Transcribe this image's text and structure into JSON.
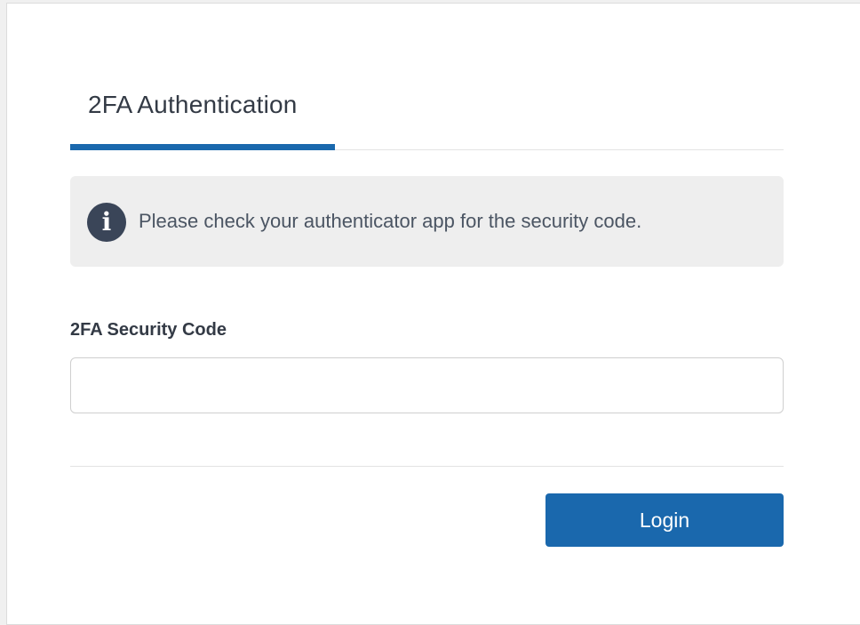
{
  "colors": {
    "accent": "#1a68ad",
    "alert_background": "#eeeeee",
    "icon_background": "#3a4558"
  },
  "tabs": [
    {
      "label": "2FA Authentication",
      "active": true
    }
  ],
  "alert": {
    "icon": "info-icon",
    "icon_glyph": "i",
    "message": "Please check your authenticator app for the security code."
  },
  "form": {
    "code_label": "2FA Security Code",
    "code_value": "",
    "code_placeholder": ""
  },
  "actions": {
    "login_label": "Login"
  }
}
